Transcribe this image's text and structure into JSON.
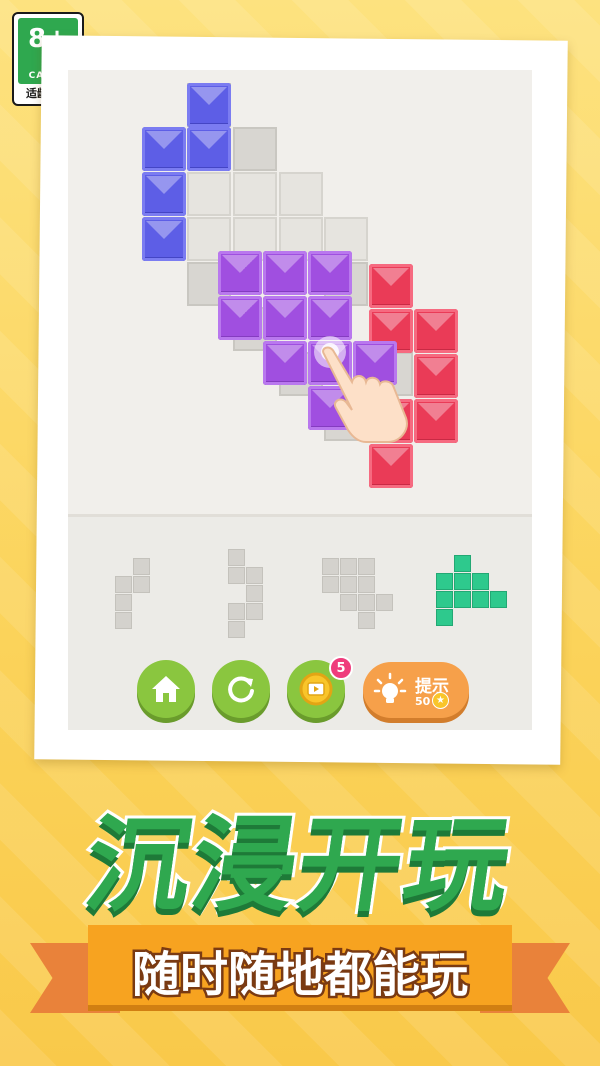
{
  "age_rating": {
    "age": "8+",
    "org": "CADPA",
    "note": "适龄提示"
  },
  "toolbar": {
    "home_icon": "home-icon",
    "restart_icon": "restart-icon",
    "video_icon": "video-coin-icon",
    "video_badge": "5",
    "hint_label": "提示",
    "hint_cost": "50",
    "hint_icon": "lightbulb-icon"
  },
  "headline": "沉浸开玩",
  "tagline": "随时随地都能玩",
  "colors": {
    "accent_green": "#2fa84f",
    "block_blue": "#5d5ee6",
    "block_purple": "#a04fe0",
    "block_red": "#ea3b57",
    "piece_green": "#2ec98d",
    "button_green": "#8ac63f",
    "hint_orange": "#f6a04a"
  }
}
